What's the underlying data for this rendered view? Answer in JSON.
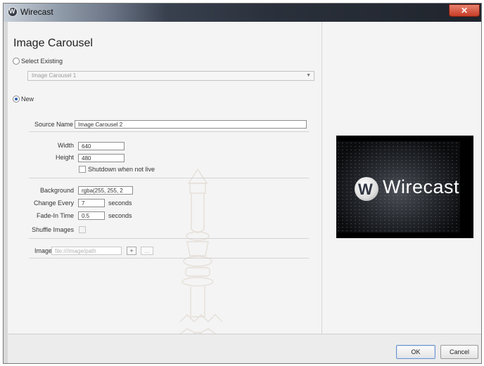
{
  "window": {
    "title": "Wirecast",
    "close_glyph": "✕"
  },
  "heading": "Image Carousel",
  "select_existing": {
    "label": "Select Existing",
    "dropdown_value": "Image Carousel 1"
  },
  "new_option": {
    "label": "New"
  },
  "source_name": {
    "label": "Source Name",
    "value": "Image Carousel 2"
  },
  "size": {
    "width_label": "Width",
    "width_value": "640",
    "height_label": "Height",
    "height_value": "480"
  },
  "shutdown": {
    "label": "Shutdown when not live",
    "checked": false
  },
  "background": {
    "label": "Background",
    "value": "rgba(255, 255, 2"
  },
  "change_every": {
    "label": "Change Every",
    "value": "7",
    "unit": "seconds"
  },
  "fade_in": {
    "label": "Fade-In Time",
    "value": "0.5",
    "unit": "seconds"
  },
  "shuffle": {
    "label": "Shuffle Images",
    "checked": false
  },
  "image": {
    "label": "Image",
    "placeholder": "file:///image/path",
    "add_glyph": "+",
    "browse_glyph": "..."
  },
  "preview": {
    "logo_text": "Wirecast",
    "logo_icon": "wirecast-logo-icon"
  },
  "footer": {
    "ok_label": "OK",
    "cancel_label": "Cancel"
  },
  "colors": {
    "accent": "#2d5eb3",
    "preview_bg": "#000000",
    "close_red": "#c53d27"
  }
}
